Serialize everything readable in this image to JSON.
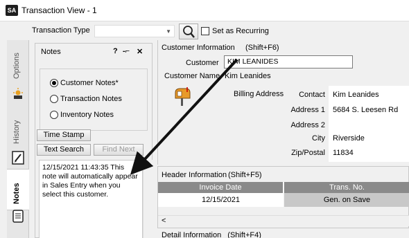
{
  "window": {
    "app_badge": "SA",
    "title": "Transaction View - 1"
  },
  "toolbar": {
    "transaction_type_label": "Transaction Type",
    "transaction_type_value": "",
    "recurring_label": "Set as Recurring"
  },
  "side_tabs": {
    "options": "Options",
    "history": "History",
    "notes": "Notes"
  },
  "notes_panel": {
    "title": "Notes",
    "help": "?",
    "pin": "-⌐",
    "close": "✕",
    "radios": [
      "Customer Notes*",
      "Transaction Notes",
      "Inventory Notes"
    ],
    "selected_radio": "Customer Notes*",
    "time_stamp_button": "Time Stamp",
    "text_search_button": "Text Search",
    "find_next_button": "Find Next",
    "note_text": "12/15/2021 11:43:35 This note will automatically appear in Sales Entry when you select this customer."
  },
  "customer_info": {
    "title": "Customer Information",
    "shortcut": "(Shift+F6)",
    "customer_label": "Customer",
    "customer_value": "KIM LEANIDES",
    "customer_name_label": "Customer Name",
    "customer_name_value": "Kim Leanides",
    "billing_address_label": "Billing Address",
    "fields": [
      {
        "label": "Contact",
        "value": "Kim Leanides"
      },
      {
        "label": "Address 1",
        "value": "5684 S. Leesen Rd"
      },
      {
        "label": "Address 2",
        "value": ""
      },
      {
        "label": "City",
        "value": "Riverside"
      },
      {
        "label": "Zip/Postal",
        "value": "11834"
      }
    ]
  },
  "header_info": {
    "title": "Header Information",
    "shortcut": "(Shift+F5)",
    "columns": [
      "Invoice Date",
      "Trans. No."
    ],
    "row": [
      "12/15/2021",
      "Gen. on Save"
    ],
    "scroll_left": "<"
  },
  "detail_info": {
    "title": "Detail Information",
    "shortcut": "(Shift+F4)"
  },
  "colors": {
    "grid_header": "#8a8a8a",
    "panel_bg": "#f0f0f0",
    "trans_cell": "#c8c8c8"
  }
}
